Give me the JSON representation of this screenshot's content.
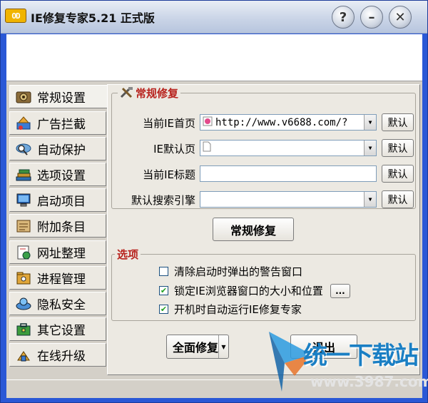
{
  "window": {
    "icon_text": "OD",
    "title": "IE修复专家5.21  正式版",
    "help_button": "?",
    "minimize_button": "–",
    "close_button": "✕"
  },
  "sidebar": {
    "items": [
      {
        "label": "常规设置",
        "icon": "settings-gear-icon"
      },
      {
        "label": "广告拦截",
        "icon": "ad-block-icon"
      },
      {
        "label": "自动保护",
        "icon": "magnifier-shield-icon"
      },
      {
        "label": "选项设置",
        "icon": "books-icon"
      },
      {
        "label": "启动项目",
        "icon": "monitor-icon"
      },
      {
        "label": "附加条目",
        "icon": "scroll-icon"
      },
      {
        "label": "网址整理",
        "icon": "web-document-icon"
      },
      {
        "label": "进程管理",
        "icon": "folder-process-icon"
      },
      {
        "label": "隐私安全",
        "icon": "globe-lock-icon"
      },
      {
        "label": "其它设置",
        "icon": "toolbox-icon"
      },
      {
        "label": "在线升级",
        "icon": "upgrade-icon"
      }
    ],
    "active_index": 0
  },
  "repair_group": {
    "title": "常规修复",
    "rows": [
      {
        "label": "当前IE首页",
        "value": "http://www.v6688.com/?",
        "type": "combo",
        "default_button": "默认"
      },
      {
        "label": "IE默认页",
        "value": "",
        "type": "combo",
        "default_button": "默认"
      },
      {
        "label": "当前IE标题",
        "value": "",
        "type": "text",
        "default_button": "默认"
      },
      {
        "label": "默认搜索引擎",
        "value": "",
        "type": "combo",
        "default_button": "默认"
      }
    ],
    "repair_button": "常规修复"
  },
  "options_group": {
    "title": "选项",
    "items": [
      {
        "label": "清除启动时弹出的警告窗口",
        "checked": false
      },
      {
        "label": "锁定IE浏览器窗口的大小和位置",
        "checked": true
      },
      {
        "label": "开机时自动运行IE修复专家",
        "checked": true
      }
    ],
    "more_button": "..."
  },
  "actions": {
    "full_repair": "全面修复",
    "full_repair_arrow": "▼",
    "exit": "退出"
  },
  "watermark": {
    "text": "统一下载站",
    "url": "www.3987.com"
  },
  "colors": {
    "window_frame": "#2a58d6",
    "group_title": "#b8231e",
    "watermark": "#1a7fc4"
  }
}
